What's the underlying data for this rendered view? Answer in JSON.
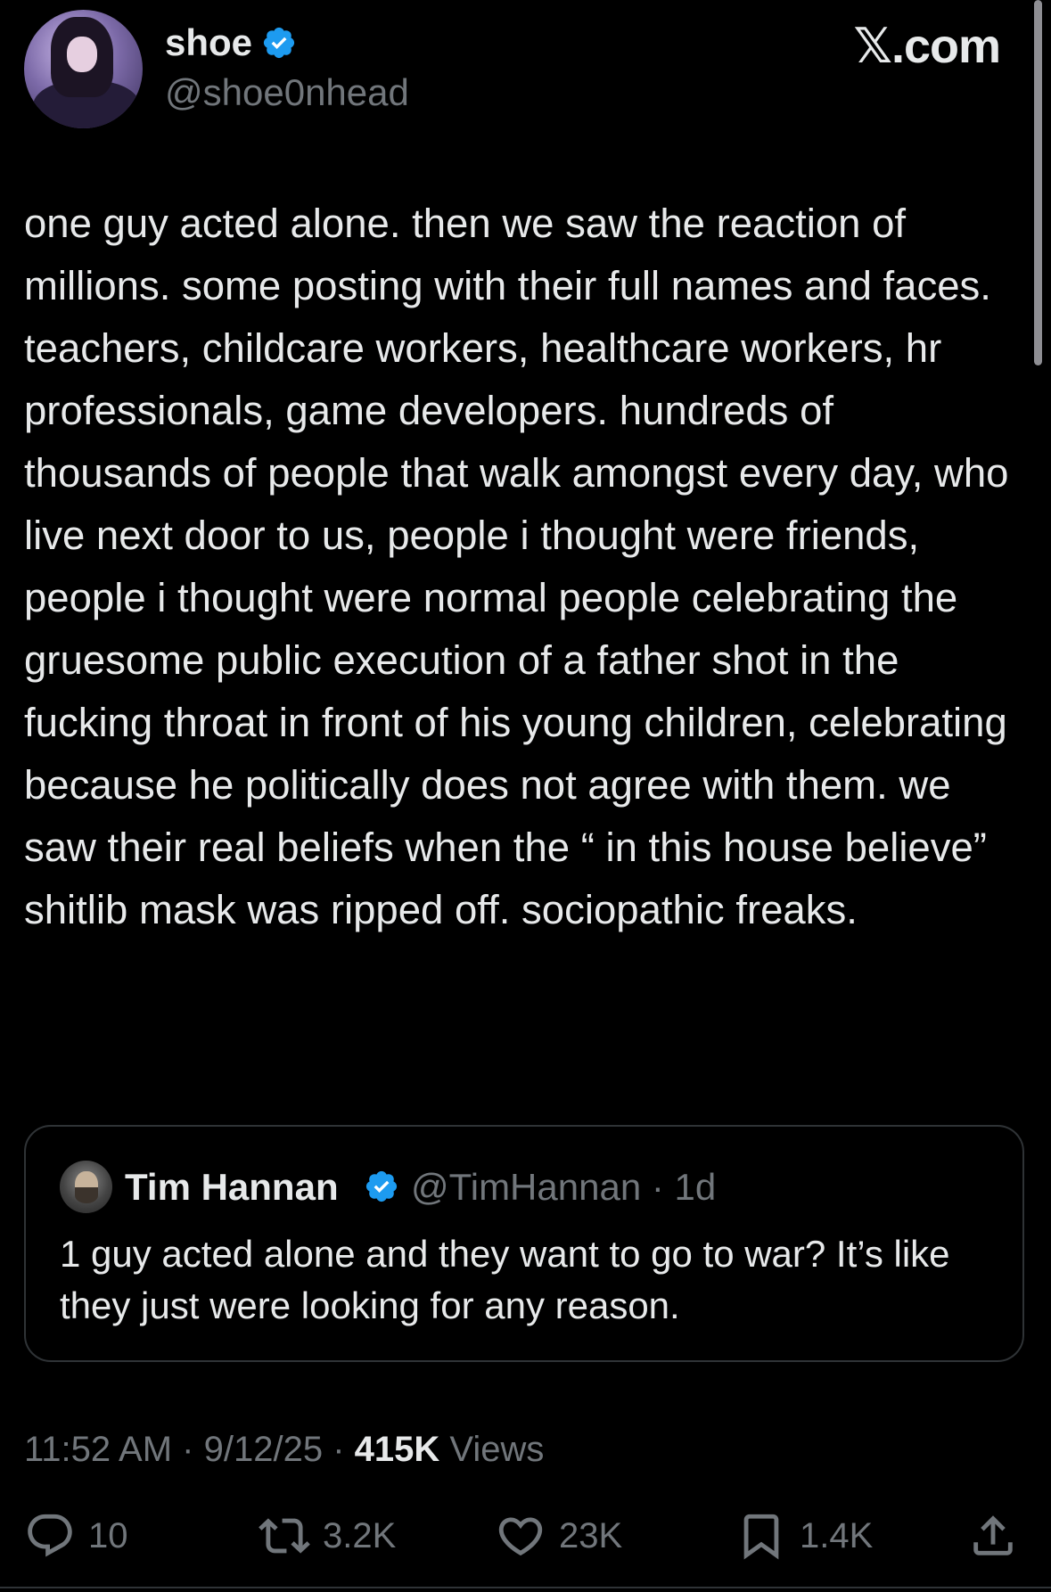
{
  "author": {
    "display_name": "shoe",
    "handle": "@shoe0nhead",
    "verified": true,
    "avatar_icon": "profile-photo"
  },
  "brand": {
    "label": "𝕏.com"
  },
  "tweet": {
    "text": "one guy acted alone. then we saw the reaction of millions. some posting with their full names and faces. teachers, childcare workers, healthcare workers, hr professionals, game developers. hundreds of thousands of people that walk amongst every day, who live next door to us, people i thought were friends, people i thought were normal people celebrating the gruesome public execution of a father shot in the fucking throat in front of his young children, celebrating because he politically does not agree with them. we saw their real beliefs when the “ in this house believe” shitlib mask was ripped off. sociopathic freaks."
  },
  "quoted_tweet": {
    "display_name": "Tim Hannan",
    "handle": "@TimHannan",
    "separator": "·",
    "age": "1d",
    "verified": true,
    "text": "1 guy acted alone and they want to go to war? It’s like they just were looking for any reason."
  },
  "meta": {
    "time": "11:52 AM",
    "separator": "·",
    "date": "9/12/25",
    "views_count": "415K",
    "views_label": "Views"
  },
  "actions": {
    "reply_count": "10",
    "retweet_count": "3.2K",
    "like_count": "23K",
    "bookmark_count": "1.4K"
  },
  "colors": {
    "background": "#000000",
    "text_primary": "#e7e9ea",
    "text_secondary": "#71767b",
    "verified_blue": "#1d9bf0",
    "border": "#2f3336"
  }
}
